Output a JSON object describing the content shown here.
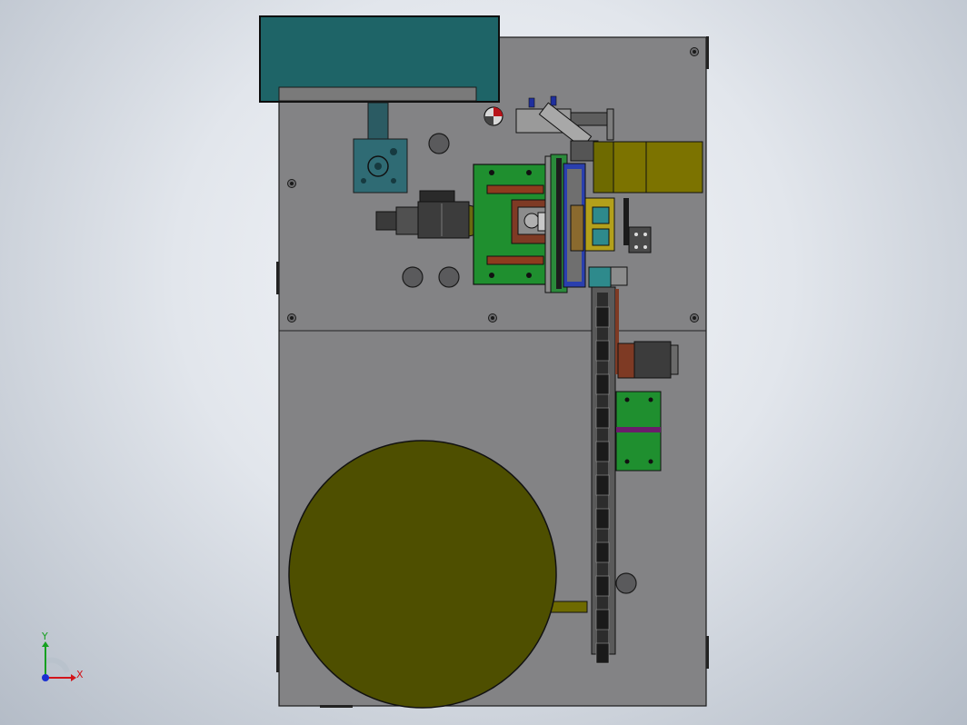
{
  "view": {
    "triad": {
      "x_label": "X",
      "y_label": "Y"
    }
  },
  "colors": {
    "background_center": "#f4f6f9",
    "background_edge": "#b4bcc7",
    "base_plate": "#838385",
    "edge": "#1b1b1b",
    "teal_hood": "#1e6467",
    "teal_block": "#2f6b74",
    "green_plate": "#1f8f2f",
    "rust_slot": "#8e3b1e",
    "olive_disc": "#4e4f00",
    "olive_box": "#6e6a00",
    "dark_part": "#3c3c3c",
    "gold_part": "#b3a01b",
    "purple_strip": "#6b1c6b",
    "blue_nozzle": "#1f2f9e",
    "axis_x": "#d2141a",
    "axis_y": "#16a020",
    "axis_z": "#1a2fd2"
  }
}
